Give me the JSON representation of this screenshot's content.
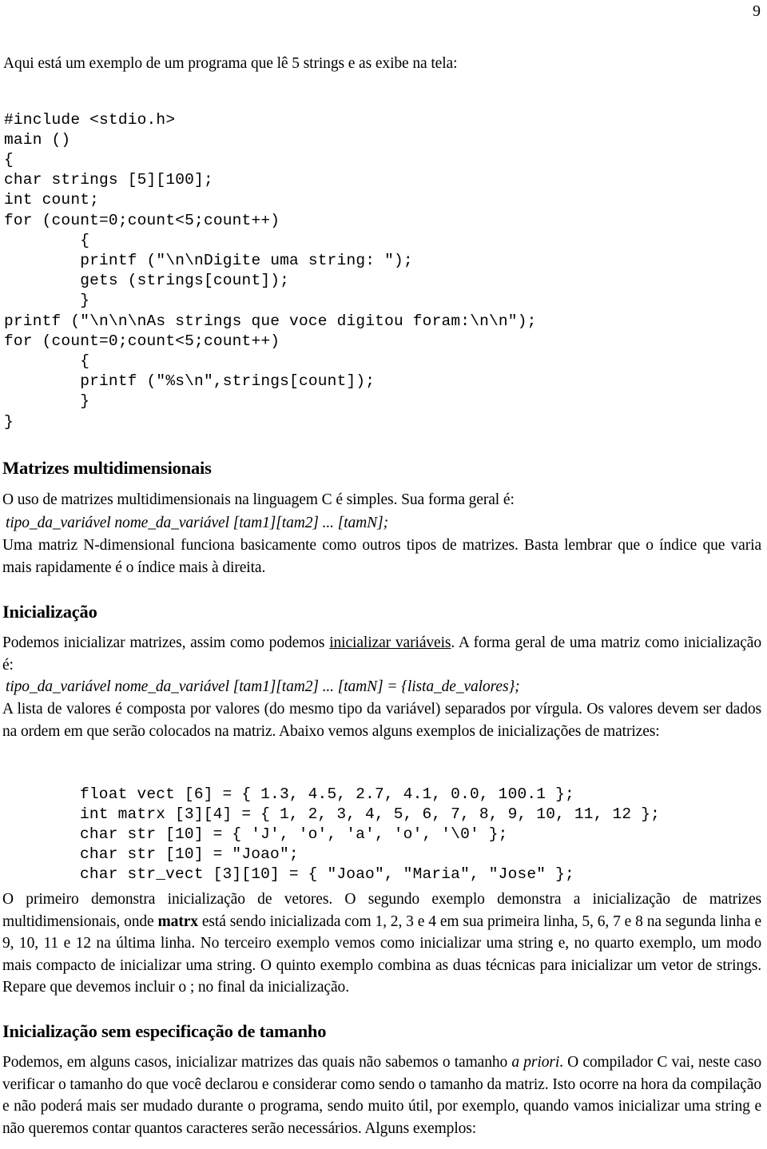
{
  "page": {
    "number": "9"
  },
  "intro": {
    "line": "Aqui está um exemplo de um programa que lê 5 strings e as exibe na tela:"
  },
  "code_program": "#include <stdio.h>\nmain ()\n{\nchar strings [5][100];\nint count;\nfor (count=0;count<5;count++)\n        {\n        printf (\"\\n\\nDigite uma string: \");\n        gets (strings[count]);\n        }\nprintf (\"\\n\\n\\nAs strings que voce digitou foram:\\n\\n\");\nfor (count=0;count<5;count++)\n        {\n        printf (\"%s\\n\",strings[count]);\n        }\n}",
  "sections": {
    "matrizes": {
      "heading": "Matrizes multidimensionais",
      "paragraph_1": "O uso de matrizes multidimensionais na linguagem C é simples. Sua forma geral é:",
      "formula": "tipo_da_variável nome_da_variável [tam1][tam2] ... [tamN];",
      "paragraph_2": " Uma matriz N-dimensional funciona basicamente como outros tipos de matrizes. Basta lembrar que o índice que varia mais rapidamente é o índice mais à direita."
    },
    "inicializacao": {
      "heading": "Inicialização",
      "paragraph_1_part_a": "Podemos inicializar matrizes, assim como podemos ",
      "paragraph_1_link": "inicializar variáveis",
      "paragraph_1_part_b": ". A forma geral de uma matriz como inicialização é:",
      "formula": "tipo_da_variável nome_da_variável [tam1][tam2] ... [tamN] = {lista_de_valores};",
      "paragraph_2": " A lista de valores é composta por valores (do mesmo tipo da variável) separados por vírgula. Os valores devem ser dados na ordem em que serão colocados na matriz. Abaixo vemos alguns exemplos de inicializações de matrizes:",
      "code_examples": "float vect [6] = { 1.3, 4.5, 2.7, 4.1, 0.0, 100.1 };\nint matrx [3][4] = { 1, 2, 3, 4, 5, 6, 7, 8, 9, 10, 11, 12 };\nchar str [10] = { 'J', 'o', 'a', 'o', '\\0' };\nchar str [10] = \"Joao\";\nchar str_vect [3][10] = { \"Joao\", \"Maria\", \"Jose\" };",
      "paragraph_3_part_a": "O primeiro demonstra inicialização de vetores. O segundo exemplo demonstra a inicialização de matrizes multidimensionais, onde ",
      "paragraph_3_bold": "matrx",
      "paragraph_3_part_b": " está sendo inicializada com 1, 2, 3 e 4 em sua primeira linha, 5, 6, 7 e 8 na segunda linha e 9, 10, 11 e 12 na última linha. No terceiro exemplo vemos como inicializar uma string e, no quarto exemplo, um modo mais compacto de inicializar uma string. O quinto exemplo combina as duas técnicas para inicializar um vetor de strings. Repare que devemos incluir o ; no final da inicialização."
    },
    "sem_tamanho": {
      "heading": "Inicialização sem especificação de tamanho",
      "paragraph_part_a": "Podemos, em alguns casos, inicializar matrizes das quais não sabemos o tamanho ",
      "paragraph_italic": "a priori",
      "paragraph_part_b": ". O compilador C vai, neste caso verificar o tamanho do que você declarou e considerar como sendo o tamanho da matriz. Isto ocorre na hora da compilação e não poderá mais ser mudado durante o programa, sendo muito útil, por exemplo, quando vamos inicializar uma string e não queremos contar quantos caracteres serão necessários. Alguns exemplos:"
    }
  },
  "colors": {
    "text": "#000000",
    "background": "#ffffff"
  }
}
